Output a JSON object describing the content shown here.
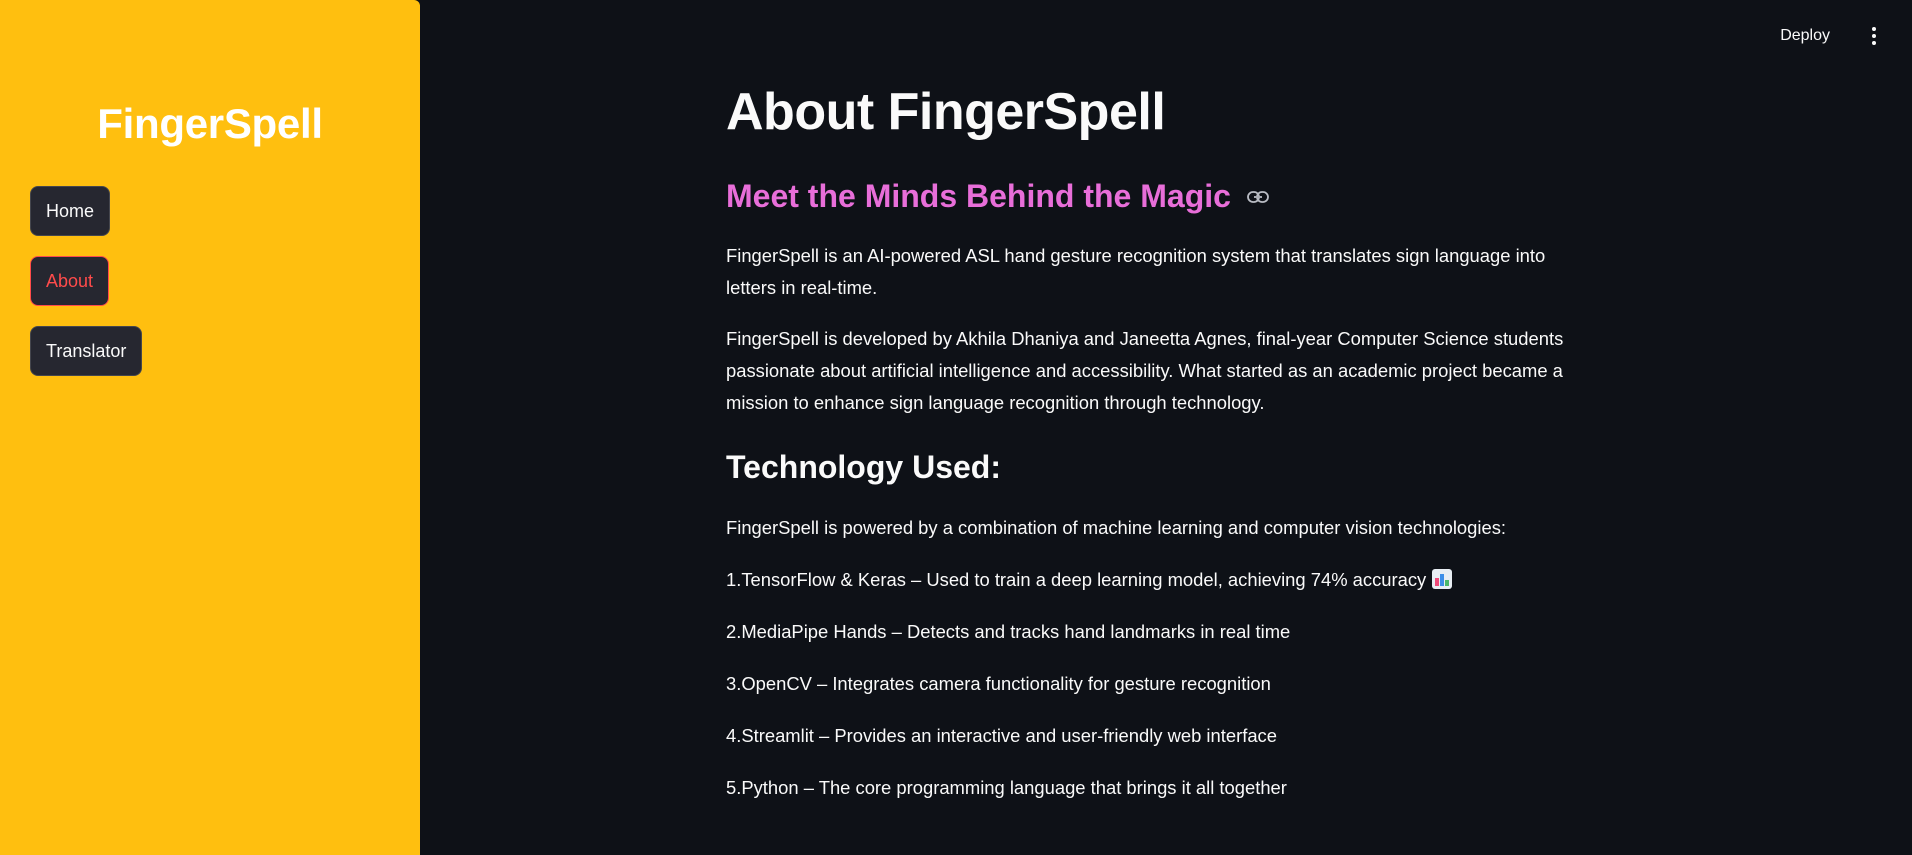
{
  "sidebar": {
    "brand": "FingerSpell",
    "nav": [
      {
        "label": "Home",
        "active": false
      },
      {
        "label": "About",
        "active": true
      },
      {
        "label": "Translator",
        "active": false
      }
    ],
    "background_color": "#ffbf0f"
  },
  "toolbar": {
    "deploy_label": "Deploy",
    "menu_icon": "kebab-menu-icon"
  },
  "main": {
    "title": "About FingerSpell",
    "subheader": "Meet the Minds Behind the Magic",
    "subheader_color": "#e86ed9",
    "anchor_icon": "link-icon",
    "intro": "FingerSpell is an AI-powered ASL hand gesture recognition system that translates sign language into letters in real-time.",
    "developers": "FingerSpell is developed by Akhila Dhaniya and Janeetta Agnes, final-year Computer Science students passionate about artificial intelligence and accessibility. What started as an academic project became a mission to enhance sign language recognition through technology.",
    "tech_heading": "Technology Used:",
    "tech_intro": "FingerSpell is powered by a combination of machine learning and computer vision technologies:",
    "tech_items": [
      "1.TensorFlow & Keras – Used to train a deep learning model, achieving 74% accuracy",
      "2.MediaPipe Hands – Detects and tracks hand landmarks in real time",
      "3.OpenCV – Integrates camera functionality for gesture recognition",
      "4.Streamlit – Provides an interactive and user-friendly web interface",
      "5.Python – The core programming language that brings it all together"
    ],
    "tech_item_1_emoji": "bar-chart-emoji-icon"
  },
  "theme": {
    "background": "#0e1117",
    "active_nav_color": "#ff4b4b",
    "button_background": "#262730"
  }
}
